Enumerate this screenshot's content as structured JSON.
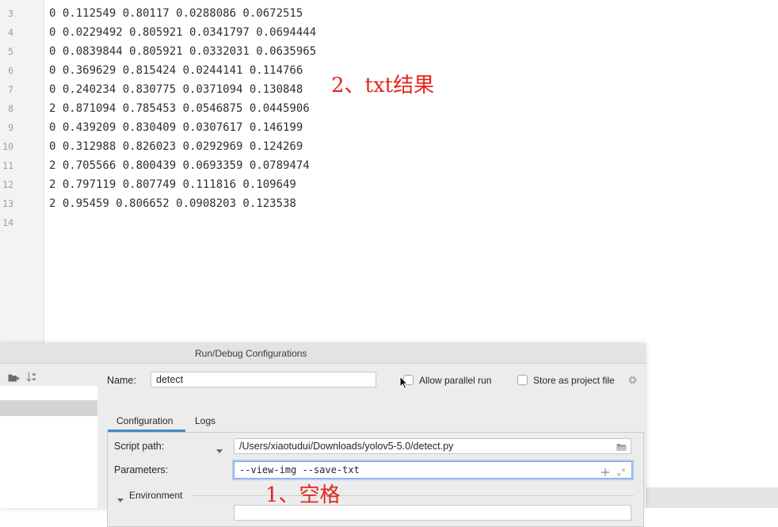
{
  "editor": {
    "lines": [
      {
        "num": "3",
        "text": "0 0.112549 0.80117 0.0288086 0.0672515"
      },
      {
        "num": "4",
        "text": "0 0.0229492 0.805921 0.0341797 0.0694444"
      },
      {
        "num": "5",
        "text": "0 0.0839844 0.805921 0.0332031 0.0635965"
      },
      {
        "num": "6",
        "text": "0 0.369629 0.815424 0.0244141 0.114766"
      },
      {
        "num": "7",
        "text": "0 0.240234 0.830775 0.0371094 0.130848"
      },
      {
        "num": "8",
        "text": "2 0.871094 0.785453 0.0546875 0.0445906"
      },
      {
        "num": "9",
        "text": "0 0.439209 0.830409 0.0307617 0.146199"
      },
      {
        "num": "10",
        "text": "0 0.312988 0.826023 0.0292969 0.124269"
      },
      {
        "num": "11",
        "text": "2 0.705566 0.800439 0.0693359 0.0789474"
      },
      {
        "num": "12",
        "text": "2 0.797119 0.807749 0.111816 0.109649"
      },
      {
        "num": "13",
        "text": "2 0.95459 0.806652 0.0908203 0.123538"
      },
      {
        "num": "14",
        "text": ""
      }
    ]
  },
  "annotations": {
    "txt_result": "2、txt结果",
    "space": "1、空格"
  },
  "dialog": {
    "title": "Run/Debug Configurations",
    "name_label": "Name:",
    "name_value": "detect",
    "allow_parallel_label": "Allow parallel run",
    "allow_parallel_checked": false,
    "store_project_label": "Store as project file",
    "store_project_checked": false,
    "tabs": [
      {
        "label": "Configuration",
        "selected": true
      },
      {
        "label": "Logs",
        "selected": false
      }
    ],
    "script_path_label": "Script path:",
    "script_path_value": "/Users/xiaotudui/Downloads/yolov5-5.0/detect.py",
    "parameters_label": "Parameters:",
    "parameters_value": "--view-img --save-txt",
    "environment_label": "Environment"
  },
  "icons": {
    "toolbar": [
      "folder-plus-icon",
      "sort-alphabetically-icon"
    ],
    "store_settings": "gear-icon",
    "script_browse": "folder-open-icon",
    "script_mode": "chevron-down-icon",
    "parameters": [
      "plus-icon",
      "expand-icon"
    ],
    "environment_toggle": "triangle-down-icon",
    "pointer": "mouse-pointer-icon"
  },
  "colors": {
    "annotation_red": "#e3261f",
    "tab_accent": "#4a88c7",
    "focus_ring": "#aecbf3"
  }
}
